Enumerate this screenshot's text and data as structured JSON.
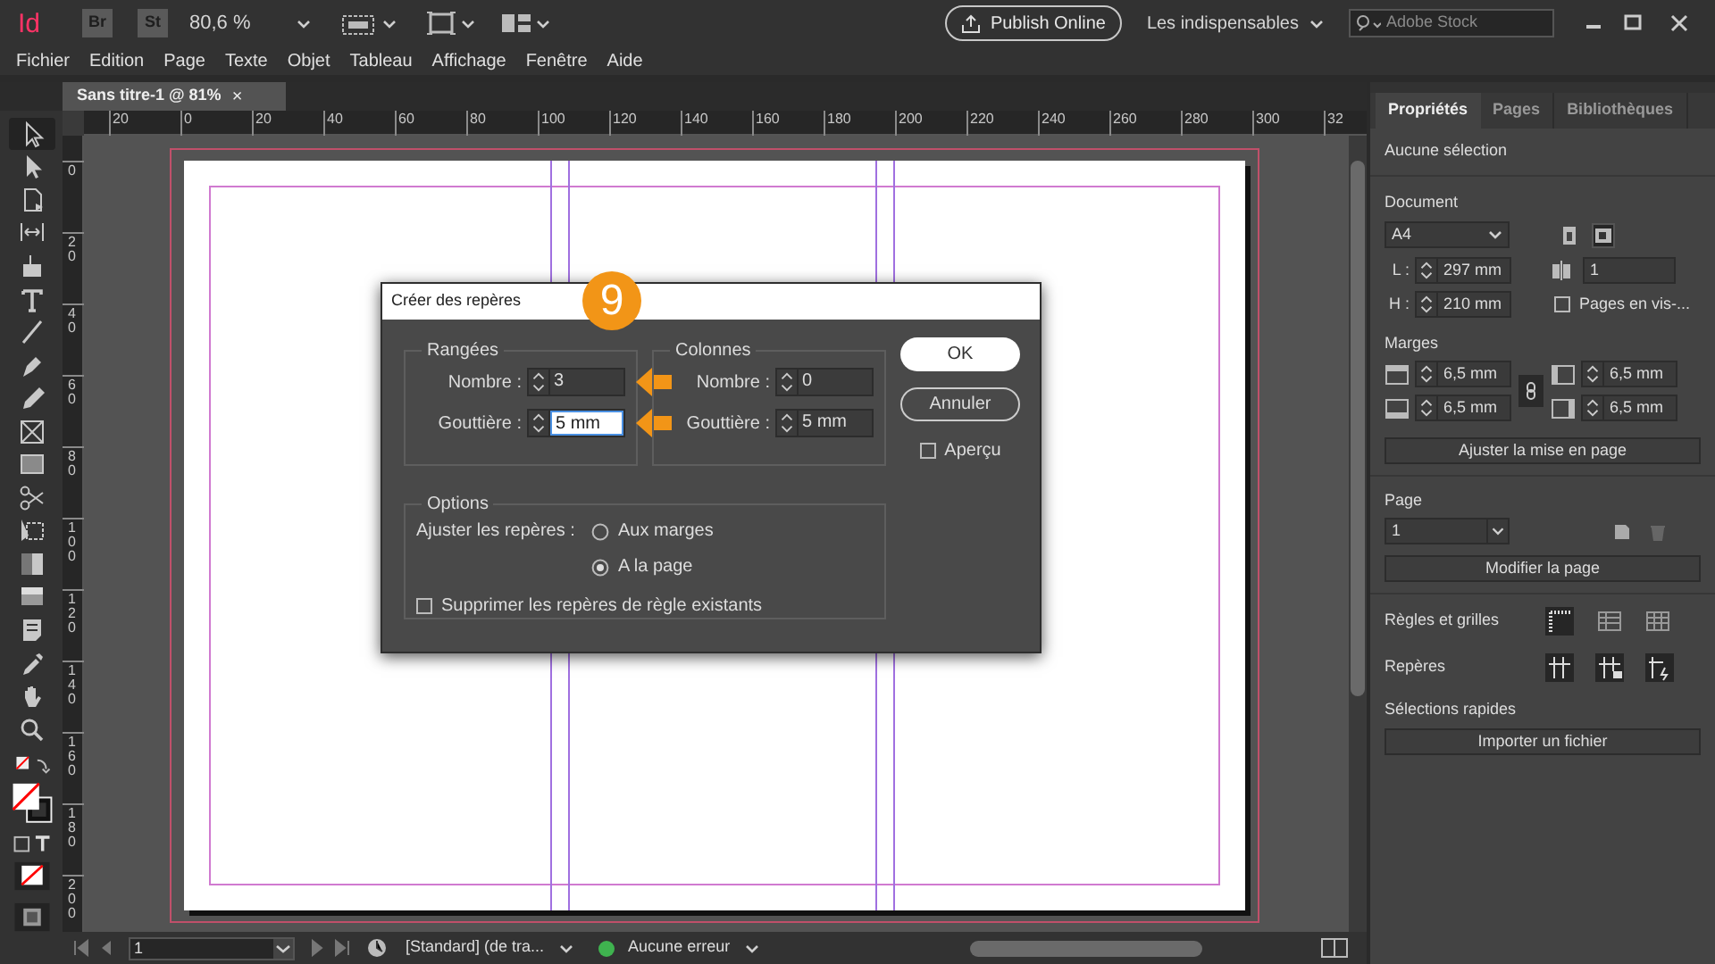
{
  "app_bar": {
    "logo": "Id",
    "bridge": "Br",
    "stock": "St",
    "zoom": "80,6 %",
    "publish_button": "Publish Online",
    "workspace": "Les indispensables",
    "search": {
      "placeholder": "Adobe Stock"
    }
  },
  "menu": [
    "Fichier",
    "Edition",
    "Page",
    "Texte",
    "Objet",
    "Tableau",
    "Affichage",
    "Fenêtre",
    "Aide"
  ],
  "document_tab": {
    "title": "Sans titre-1 @ 81%",
    "close": "×"
  },
  "ruler": {
    "horizontal": [
      "20",
      "0",
      "20",
      "40",
      "60",
      "80",
      "100",
      "120",
      "140",
      "160",
      "180",
      "200",
      "220",
      "240",
      "260",
      "280",
      "300",
      "32"
    ],
    "vertical": [
      "0",
      "20",
      "40",
      "60",
      "80",
      "100",
      "120",
      "140",
      "160",
      "180",
      "200"
    ]
  },
  "tools": [
    {
      "selected": true
    },
    {
      "selected": false
    },
    {
      "selected": false
    },
    {
      "selected": false
    },
    {
      "selected": false
    },
    {
      "selected": false
    },
    {
      "selected": false
    },
    {
      "selected": false
    },
    {
      "selected": false
    },
    {
      "selected": false
    },
    {
      "selected": false
    },
    {
      "selected": false
    },
    {
      "selected": false
    },
    {
      "selected": false
    },
    {
      "selected": false
    },
    {
      "selected": false
    },
    {
      "selected": false
    },
    {
      "selected": false
    },
    {
      "selected": false
    }
  ],
  "dialog": {
    "title": "Créer des repères",
    "badge": "9",
    "rows": {
      "title": "Rangées",
      "fields": [
        {
          "label": "Nombre :",
          "value": "3",
          "focused": false,
          "arrow": true
        },
        {
          "label": "Gouttière :",
          "value": "5 mm",
          "focused": true,
          "arrow": true
        }
      ]
    },
    "columns": {
      "title": "Colonnes",
      "fields": [
        {
          "label": "Nombre :",
          "value": "0",
          "focused": false,
          "arrow": false
        },
        {
          "label": "Gouttière :",
          "value": "5 mm",
          "focused": false,
          "arrow": false
        }
      ]
    },
    "buttons": [
      {
        "label": "OK",
        "default": true
      },
      {
        "label": "Annuler",
        "default": false
      }
    ],
    "preview": {
      "label": "Aperçu",
      "checked": false
    },
    "options": {
      "title": "Options",
      "fit_label": "Ajuster les repères :",
      "choices": [
        {
          "label": "Aux marges",
          "selected": false
        },
        {
          "label": "A la page",
          "selected": true
        }
      ],
      "remove": {
        "label": "Supprimer les repères de règle existants",
        "checked": false
      }
    }
  },
  "panel": {
    "tabs": [
      {
        "label": "Propriétés",
        "selected": true
      },
      {
        "label": "Pages",
        "selected": false
      },
      {
        "label": "Bibliothèques",
        "selected": false
      }
    ],
    "selection": "Aucune sélection",
    "document": {
      "title": "Document",
      "preset": "A4",
      "orientation": [
        {
          "selected": false
        },
        {
          "selected": true
        }
      ],
      "width_label": "L :",
      "width": "297 mm",
      "height_label": "H :",
      "height": "210 mm",
      "pages": "1",
      "facing": {
        "label": "Pages en vis-...",
        "checked": false
      }
    },
    "margins": {
      "title": "Marges",
      "values": [
        "6,5 mm",
        "6,5 mm",
        "6,5 mm",
        "6,5 mm"
      ],
      "adjust_button": "Ajuster la mise en page"
    },
    "page": {
      "title": "Page",
      "value": "1",
      "button": "Modifier la page"
    },
    "rulers_label": "Règles et grilles",
    "guides_label": "Repères",
    "quick_title": "Sélections rapides",
    "import_button": "Importer un fichier"
  },
  "status_bar": {
    "page": "1",
    "style": "[Standard] (de tra...",
    "errors": "Aucune erreur",
    "status_dot": {
      "color": "#3fb34f"
    }
  }
}
